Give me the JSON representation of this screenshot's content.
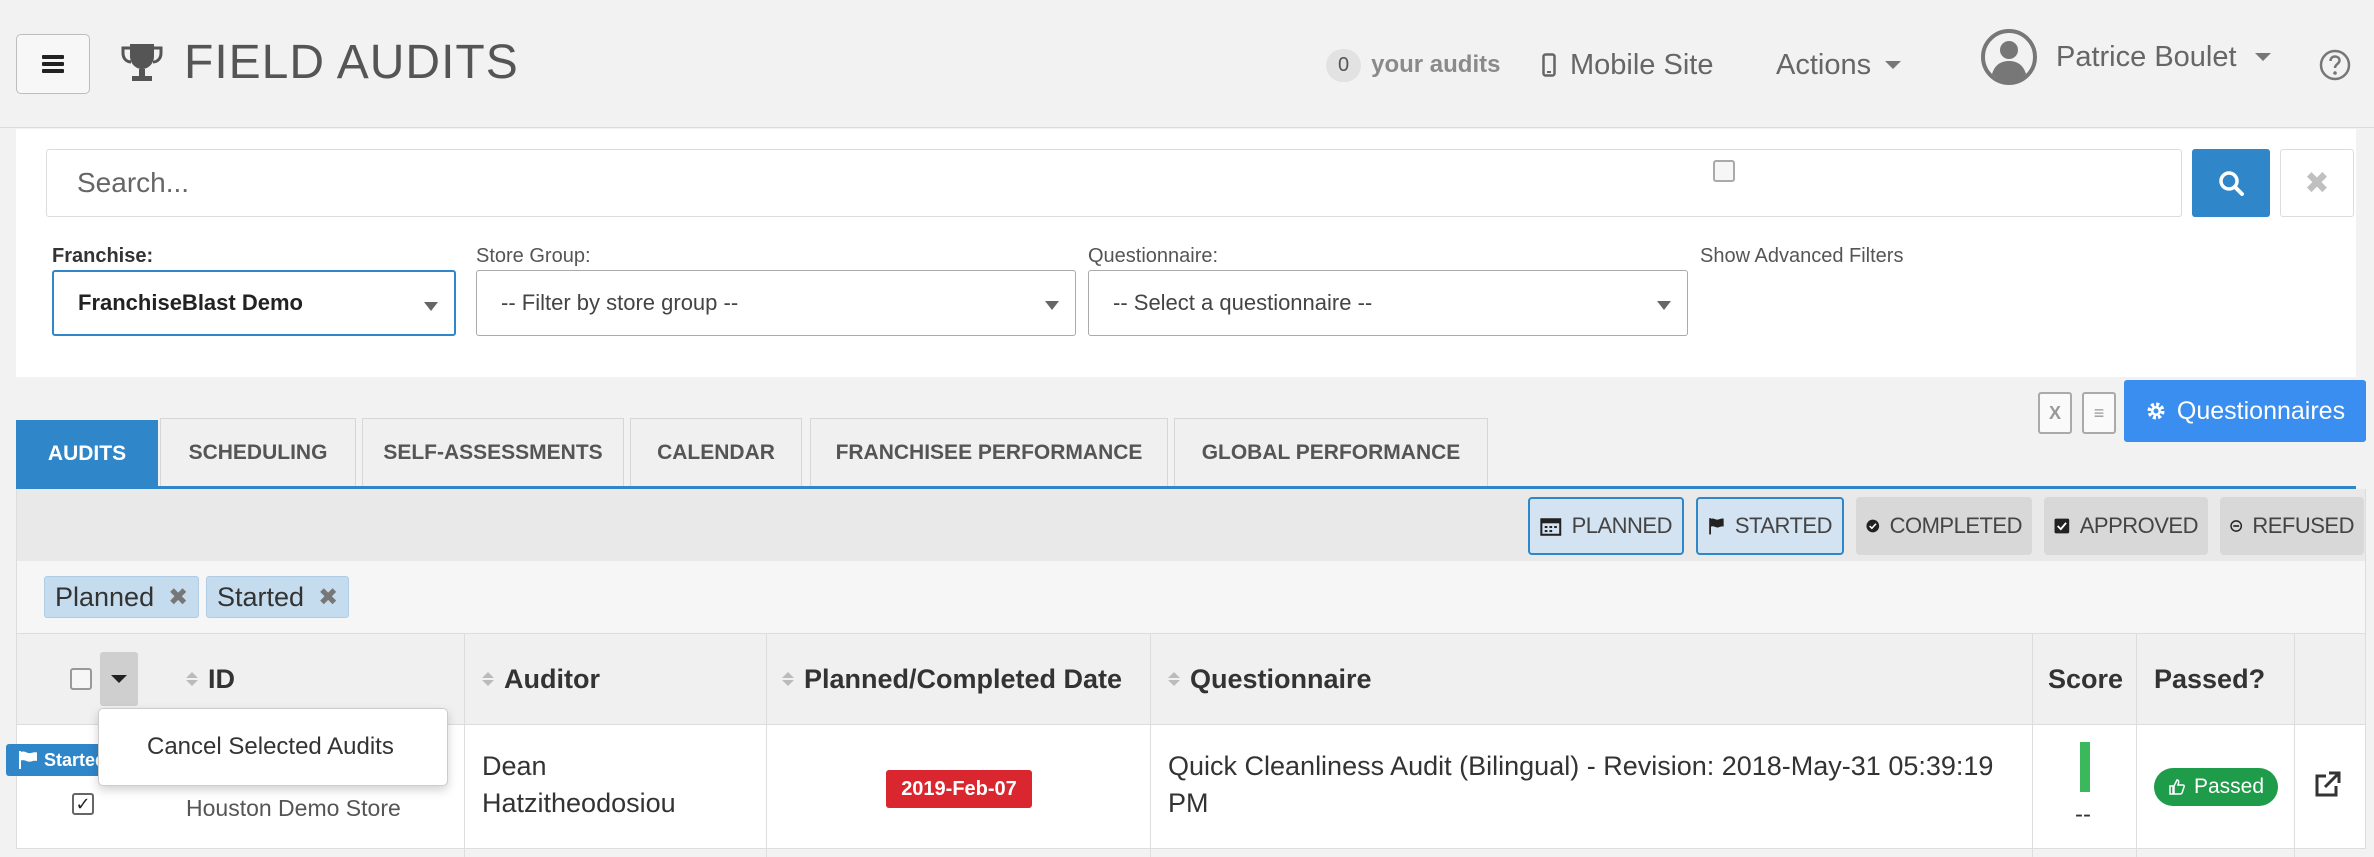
{
  "header": {
    "title": "FIELD AUDITS",
    "audit_count": "0",
    "audits_label": "your audits",
    "mobile_label": "Mobile Site",
    "actions_label": "Actions",
    "user_name": "Patrice Boulet"
  },
  "search": {
    "placeholder": "Search..."
  },
  "filters": {
    "franchise_label": "Franchise:",
    "franchise_value": "FranchiseBlast Demo",
    "store_group_label": "Store Group:",
    "store_group_value": "-- Filter by store group --",
    "questionnaire_label": "Questionnaire:",
    "questionnaire_value": "-- Select a questionnaire --",
    "advanced_label": "Show Advanced Filters"
  },
  "tabs": [
    "AUDITS",
    "SCHEDULING",
    "SELF-ASSESSMENTS",
    "CALENDAR",
    "FRANCHISEE PERFORMANCE",
    "GLOBAL PERFORMANCE"
  ],
  "questionnaires_button": "Questionnaires",
  "statuses": [
    "PLANNED",
    "STARTED",
    "COMPLETED",
    "APPROVED",
    "REFUSED"
  ],
  "active_chips": [
    "Planned",
    "Started"
  ],
  "table": {
    "columns": [
      "ID",
      "Auditor",
      "Planned/Completed Date",
      "Questionnaire",
      "Score",
      "Passed?"
    ],
    "rows": [
      {
        "status_flag": "Started",
        "store": "Houston Demo Store",
        "auditor_line1": "Dean",
        "auditor_line2": "Hatzitheodosiou",
        "date": "2019-Feb-07",
        "questionnaire_line1": "Quick Cleanliness Audit (Bilingual) - Revision: 2018-May-31 05:39:19",
        "questionnaire_line2": "PM",
        "score": "--",
        "passed": "Passed"
      }
    ]
  },
  "bulk_menu": {
    "cancel_label": "Cancel Selected Audits"
  },
  "colors": {
    "primary": "#2f86c8",
    "danger": "#d9262f",
    "success": "#1e9c4a"
  }
}
